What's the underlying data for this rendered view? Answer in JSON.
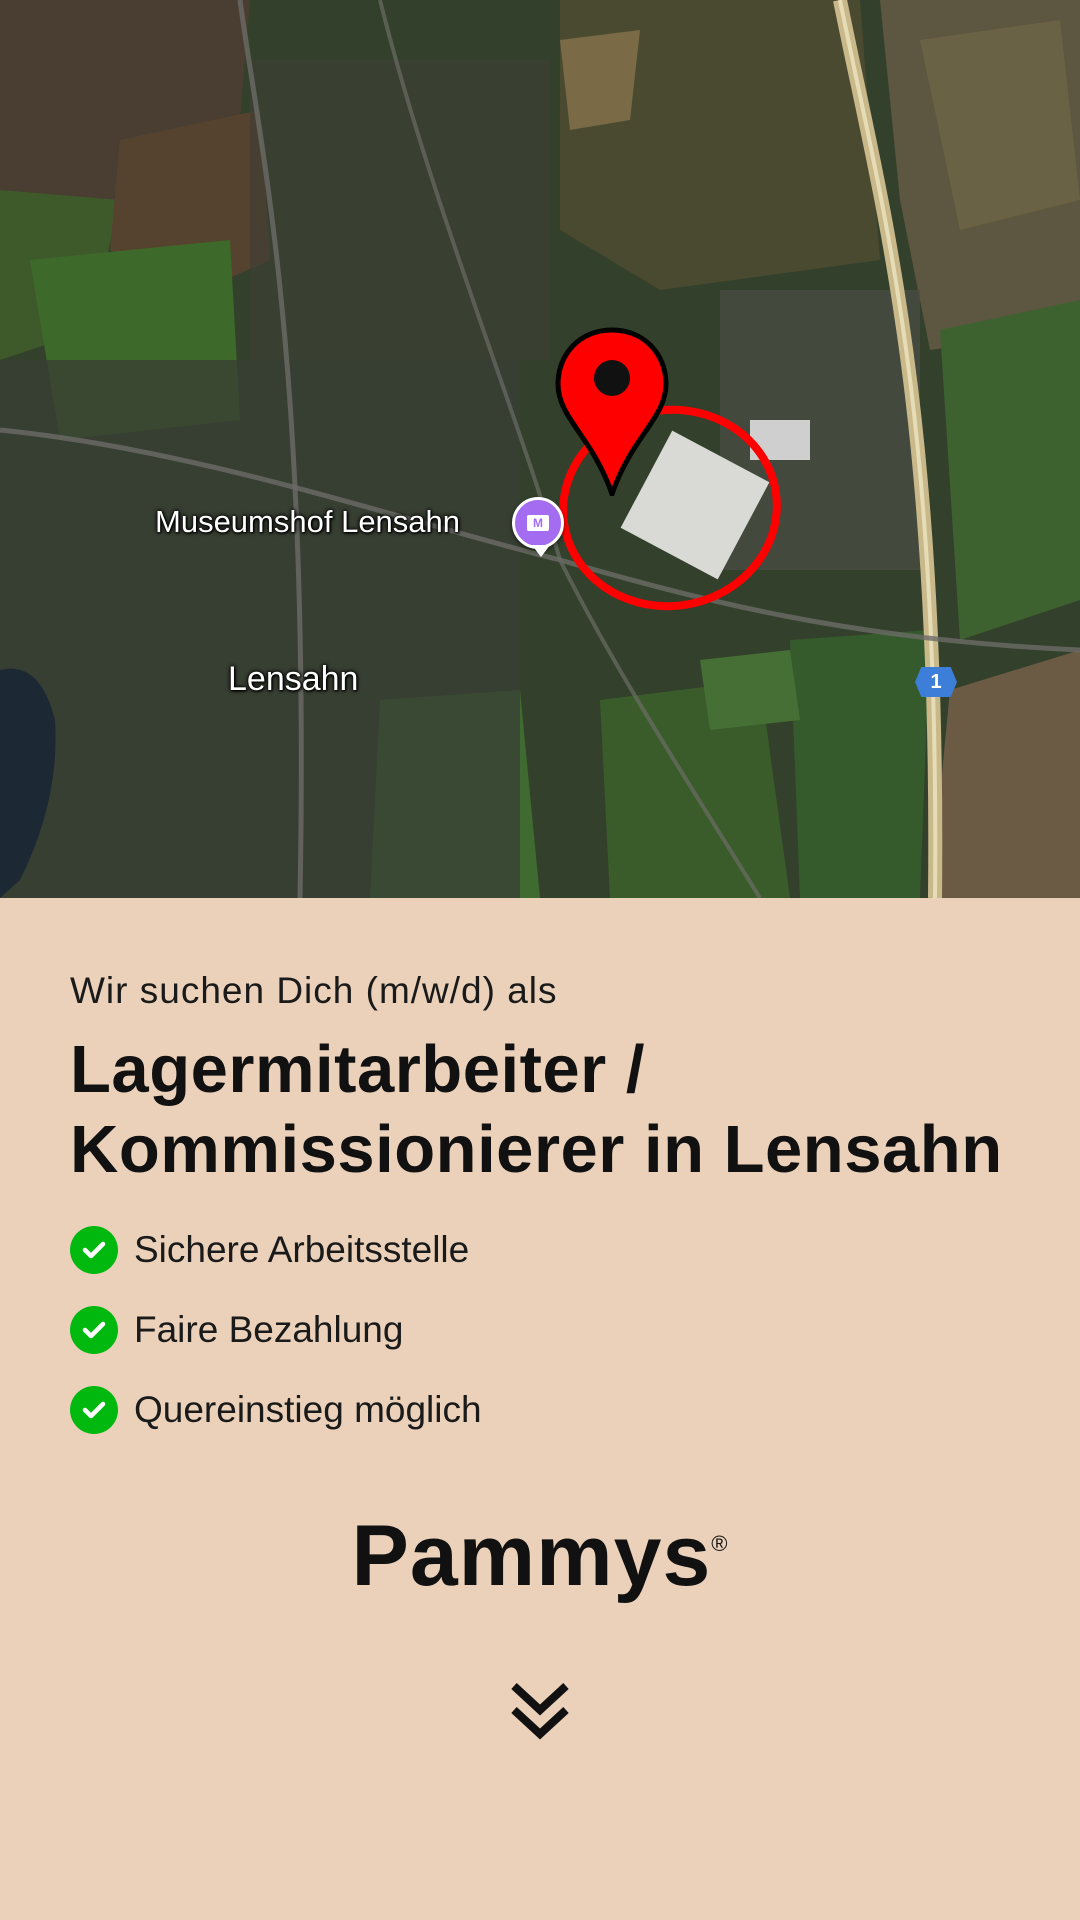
{
  "map": {
    "labels": {
      "museum": "Museumshof Lensahn",
      "town": "Lensahn",
      "road_number": "1"
    },
    "poi_icon": "museum-icon",
    "pin_icon": "location-pin-icon",
    "pin_color": "#ff0000"
  },
  "job": {
    "eyebrow": "Wir suchen Dich (m/w/d) als",
    "title_line1": "Lagermitarbeiter /",
    "title_line2": "Kommissionierer in Lensahn"
  },
  "benefits": [
    {
      "icon": "checkmark-circle-icon",
      "label": "Sichere Arbeitsstelle"
    },
    {
      "icon": "checkmark-circle-icon",
      "label": "Faire Bezahlung"
    },
    {
      "icon": "checkmark-circle-icon",
      "label": "Quereinstieg möglich"
    }
  ],
  "brand": {
    "name": "Pammys",
    "registered_mark": "®"
  },
  "scroll_icon": "double-chevron-down-icon",
  "colors": {
    "background": "#ebd1ba",
    "check": "#00b80e",
    "text": "#111111"
  }
}
